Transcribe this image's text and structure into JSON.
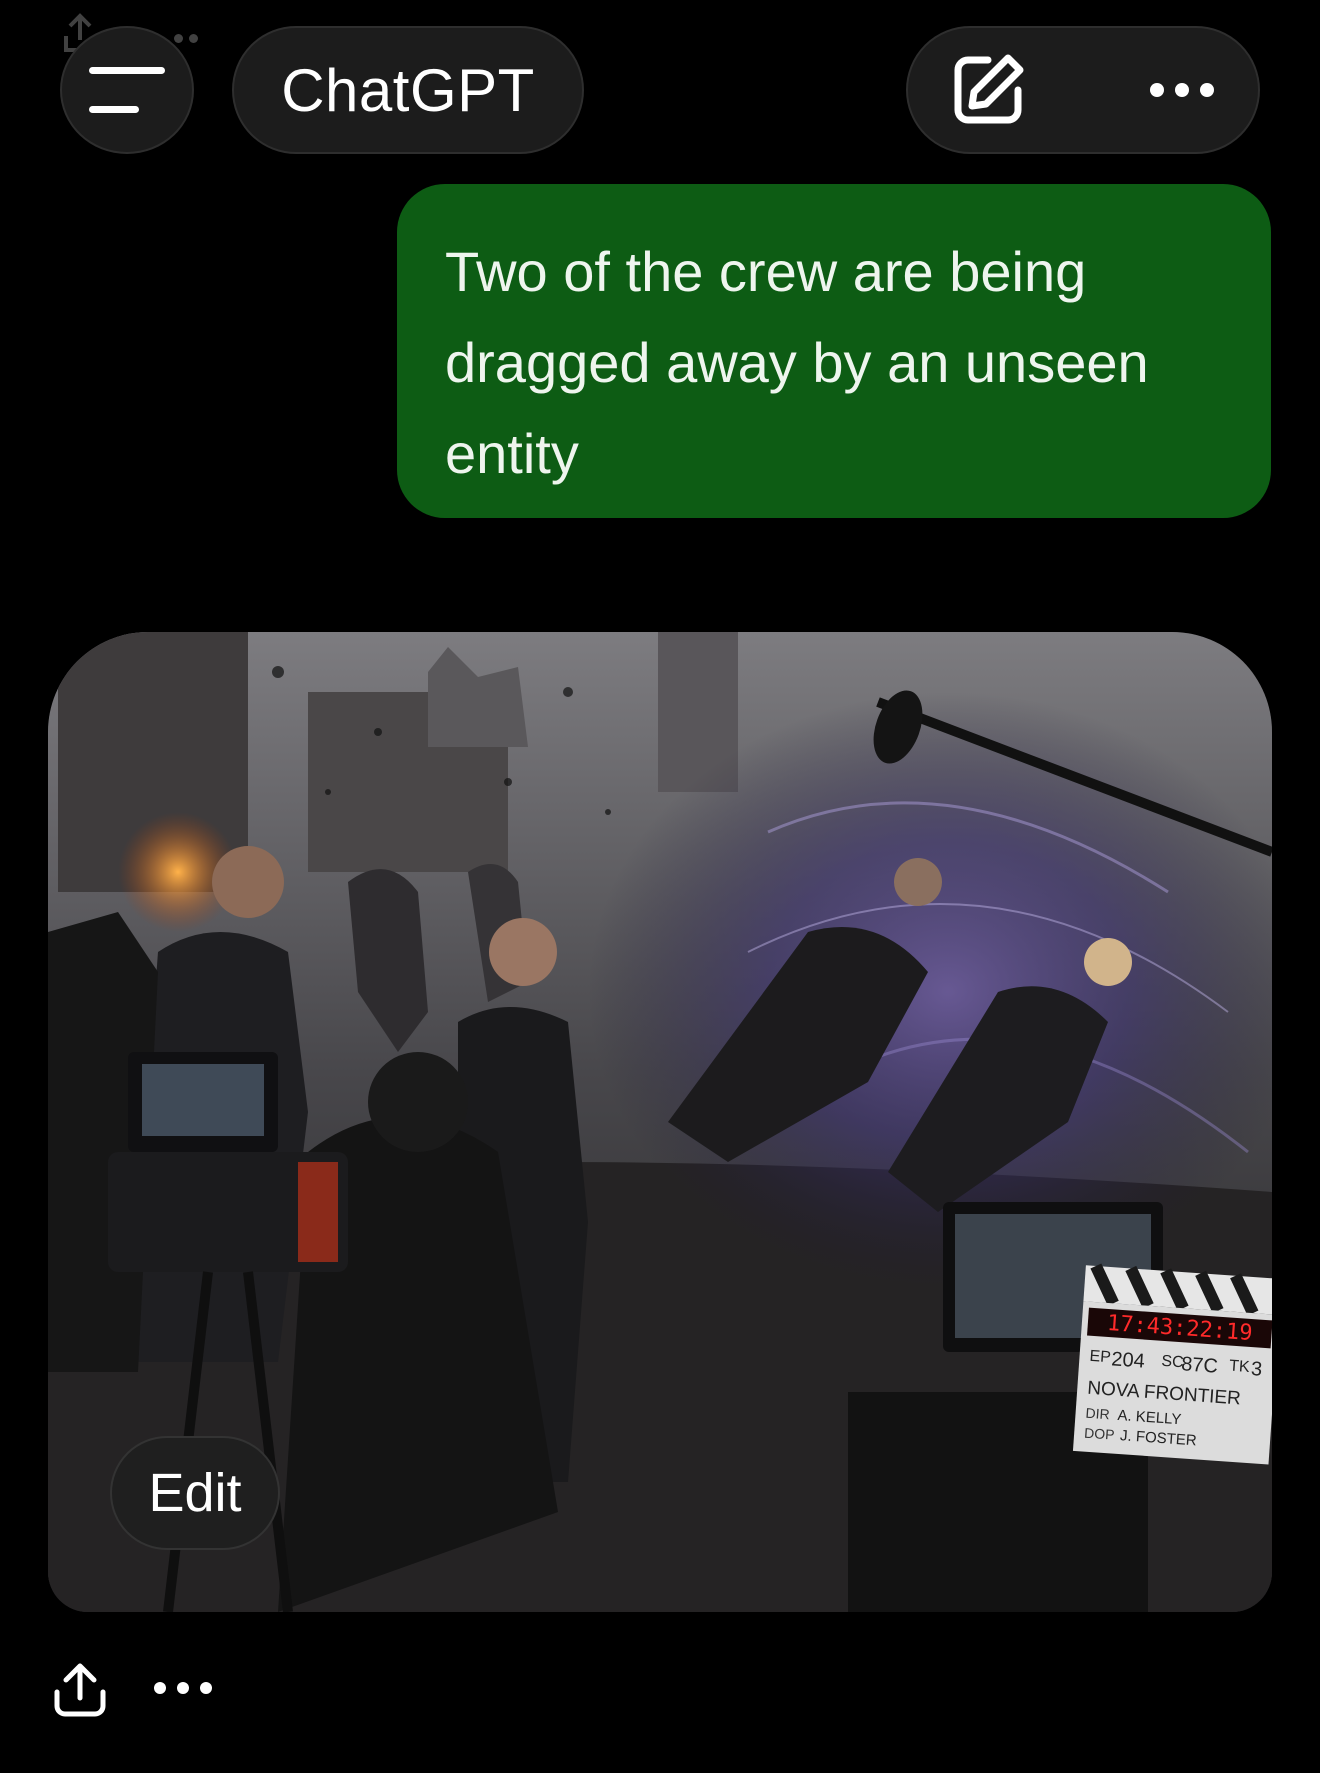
{
  "header": {
    "menu_icon": "hamburger-menu-icon",
    "title": "ChatGPT",
    "new_chat_icon": "compose-icon",
    "more_icon": "ellipsis-icon"
  },
  "conversation": {
    "user_message": "Two of the crew are being dragged away by an unseen entity",
    "user_bubble_color": "#0d5c14",
    "image": {
      "edit_label": "Edit",
      "slate": {
        "timecode": "17:43:22:19",
        "ep": "204",
        "sc": "87C",
        "tk": "3",
        "production": "NOVA FRONTIER",
        "dir": "A. KELLY",
        "dop": "J. FOSTER"
      }
    },
    "actions": {
      "share_icon": "share-icon",
      "more_icon": "ellipsis-icon"
    }
  }
}
